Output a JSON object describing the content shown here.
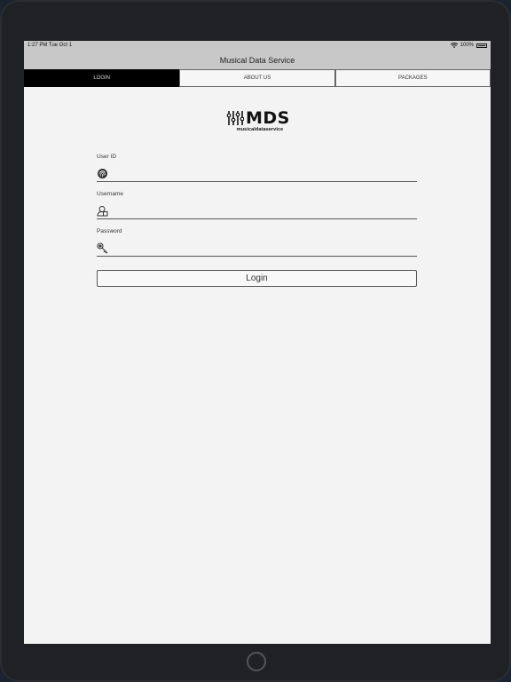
{
  "status_bar": {
    "time": "1:27 PM  Tue Oct 1",
    "battery": "100%"
  },
  "nav": {
    "title": "Musical Data Service"
  },
  "tabs": [
    {
      "label": "LOGIN",
      "active": true
    },
    {
      "label": "ABOUT US",
      "active": false
    },
    {
      "label": "PACKAGES",
      "active": false
    }
  ],
  "logo": {
    "text": "MDS",
    "subtitle": "musicaldataservice"
  },
  "form": {
    "user_id": {
      "label": "User ID",
      "value": "",
      "icon": "fingerprint-icon"
    },
    "username": {
      "label": "Username",
      "value": "",
      "icon": "user-icon"
    },
    "password": {
      "label": "Password",
      "value": "",
      "icon": "key-icon"
    },
    "login_label": "Login"
  }
}
